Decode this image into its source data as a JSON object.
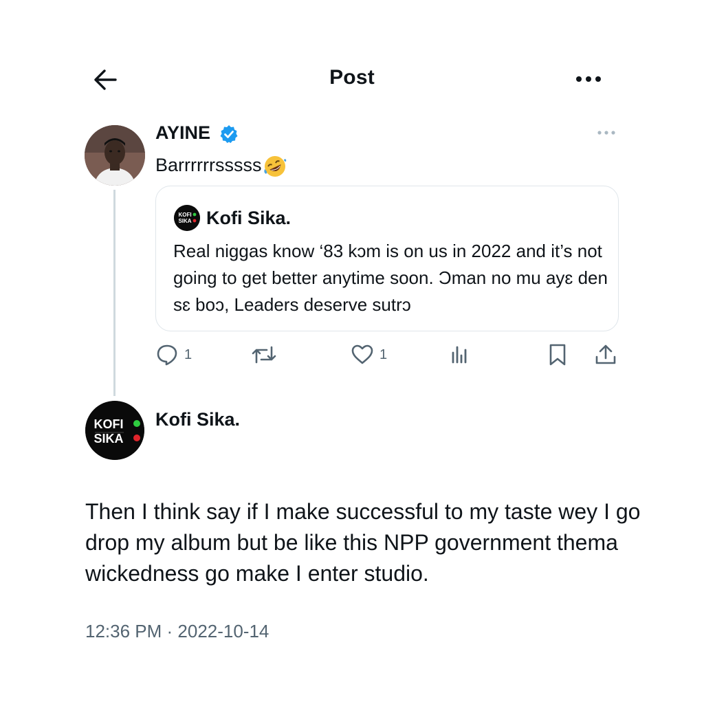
{
  "header": {
    "title": "Post",
    "back_icon": "arrow-left-icon",
    "more_icon": "more-horizontal-icon"
  },
  "parent_tweet": {
    "author": "AYINE",
    "verified": true,
    "text": "Barrrrrrsssss",
    "emoji": "rolling-on-floor-laughing",
    "quote": {
      "avatar_line1": "KOFI",
      "avatar_line2": "SIKA",
      "author": "Kofi Sika.",
      "text": "Real niggas know ‘83 kɔm is on us in 2022 and it’s not going to get better anytime soon. Ɔman no mu ayɛ den sɛ boɔ, Leaders deserve sutrɔ"
    },
    "actions": {
      "reply_count": "1",
      "retweet_count": "",
      "like_count": "1"
    }
  },
  "main_tweet": {
    "avatar_line1": "KOFI",
    "avatar_line2": "SIKA",
    "author": "Kofi Sika.",
    "text": "Then I think say if I make successful to my taste wey I go drop my album but be like this NPP government thema wickedness go make I enter studio.",
    "timestamp": "12:36 PM · 2022-10-14"
  },
  "colors": {
    "text": "#0f1419",
    "secondary": "#536471",
    "verified": "#1d9bf0",
    "border": "#dfe5ea",
    "green_dot": "#2ecc40",
    "red_dot": "#e0242b"
  }
}
